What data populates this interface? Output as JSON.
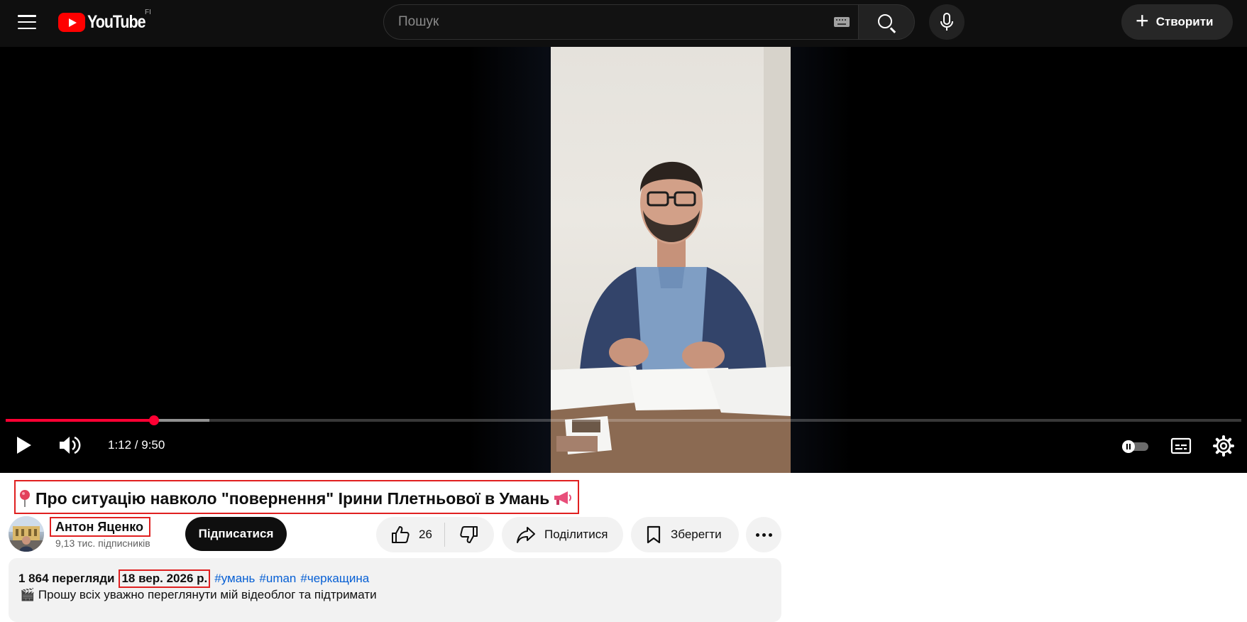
{
  "header": {
    "logo_text": "YouTube",
    "country_code": "FI",
    "search_placeholder": "Пошук",
    "create_label": "Створити"
  },
  "player": {
    "time": "1:12 / 9:50",
    "progress_played_fraction": 0.12,
    "progress_buffered_fraction": 0.165,
    "accent_color": "#ff0033"
  },
  "video": {
    "title": "Про ситуацію навколо \"повернення\" Ірини Плетньової в Умань",
    "title_leading_emoji": "round-pushpin-icon",
    "title_trailing_emoji": "loudspeaker-icon"
  },
  "channel": {
    "name": "Антон Яценко",
    "subscribers": "9,13 тис. підписників",
    "subscribe_label": "Підписатися"
  },
  "actions": {
    "like_count": "26",
    "share_label": "Поділитися",
    "save_label": "Зберегти"
  },
  "description": {
    "views": "1 864 перегляди",
    "date": "18 вер. 2026 р.",
    "tags": [
      "#умань",
      "#uman",
      "#черкащина"
    ],
    "line1": "🎬 Прошу всіх уважно переглянути мій відеоблог та підтримати"
  }
}
